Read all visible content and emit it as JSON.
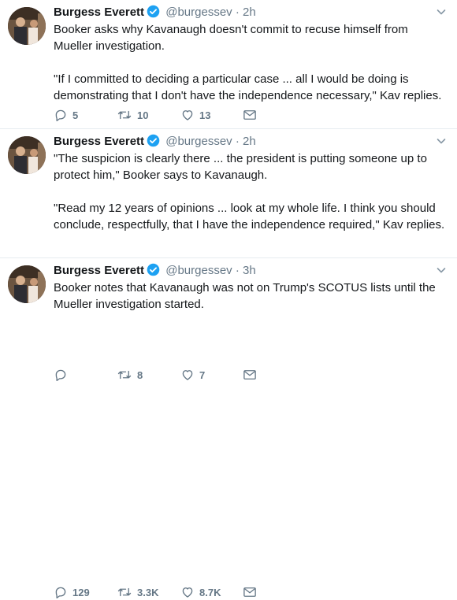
{
  "tweets": [
    {
      "author": "Burgess Everett",
      "handle": "@burgessev",
      "separator": "·",
      "time": "2h",
      "paragraphs": [
        "Booker asks why Kavanaugh doesn't commit to recuse himself from Mueller investigation.",
        "\"If I committed to deciding a particular case ... all I would be doing is demonstrating that I don't have the independence necessary,\" Kav replies."
      ],
      "replies": "5",
      "retweets": "10",
      "likes": "13"
    },
    {
      "author": "Burgess Everett",
      "handle": "@burgessev",
      "separator": "·",
      "time": "2h",
      "paragraphs": [
        "\"The suspicion is clearly there ... the president is putting someone up to protect him,\" Booker says to Kavanaugh.",
        "\"Read my 12 years of opinions ... look at my whole life. I think you should conclude, respectfully, that I have the independence required,\" Kav replies."
      ],
      "replies": "",
      "retweets": "8",
      "likes": "7"
    },
    {
      "author": "Burgess Everett",
      "handle": "@burgessev",
      "separator": "·",
      "time": "3h",
      "paragraphs": [
        "Booker notes that Kavanaugh was not on Trump's SCOTUS lists until the Mueller investigation started."
      ],
      "replies": "129",
      "retweets": "3.3K",
      "likes": "8.7K"
    }
  ],
  "icons": {
    "verified": "verified-badge-icon",
    "menu": "chevron-down-icon",
    "reply": "reply-icon",
    "retweet": "retweet-icon",
    "like": "heart-icon",
    "message": "envelope-icon"
  },
  "colors": {
    "name": "#14171a",
    "meta": "#657786",
    "verified": "#1da1f2",
    "divider": "#e6ecf0"
  }
}
